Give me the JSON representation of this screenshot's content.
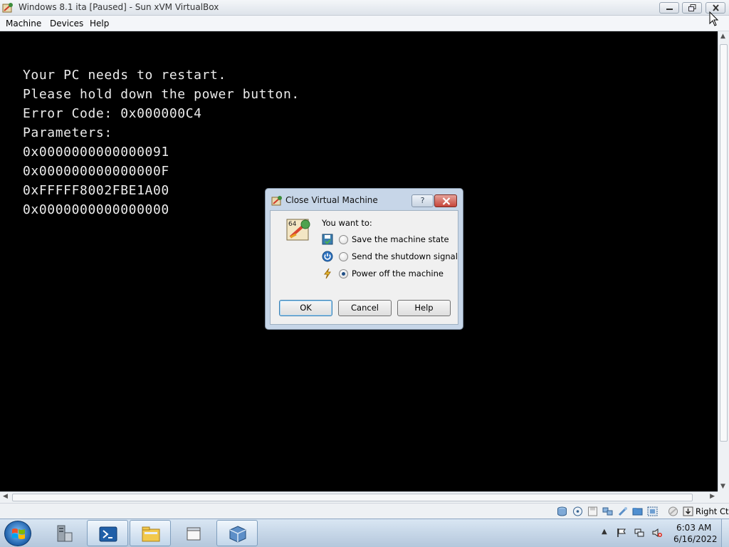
{
  "window": {
    "title": "Windows 8.1 ita [Paused] - Sun xVM VirtualBox",
    "controls": [
      "minimize",
      "restore",
      "close"
    ]
  },
  "menubar": {
    "items": [
      "Machine",
      "Devices",
      "Help"
    ]
  },
  "vm_screen": {
    "lines": [
      "Your PC needs to restart.",
      "Please hold down the power button.",
      "Error Code: 0x000000C4",
      "Parameters:",
      "0x0000000000000091",
      "0x000000000000000F",
      "0xFFFFF8002FBE1A00",
      "0x0000000000000000"
    ]
  },
  "dialog": {
    "title": "Close Virtual Machine",
    "help_glyph": "?",
    "prompt": "You want to:",
    "options": [
      {
        "label": "Save the machine state",
        "checked": false,
        "icon": "save-state-icon"
      },
      {
        "label": "Send the shutdown signal",
        "checked": false,
        "icon": "power-icon"
      },
      {
        "label": "Power off the machine",
        "checked": true,
        "icon": "lightning-icon"
      }
    ],
    "buttons": {
      "ok": "OK",
      "cancel": "Cancel",
      "help": "Help"
    }
  },
  "statusbar": {
    "icons": [
      "hard-disk-icon",
      "cd-icon",
      "floppy-icon",
      "network-icon",
      "usb-icon",
      "shared-folder-icon",
      "vrdp-icon",
      "mouse-integration-icon",
      "host-key-icon"
    ],
    "host_key": "Right Ctrl"
  },
  "taskbar": {
    "apps": [
      "server-manager-icon",
      "powershell-icon",
      "file-explorer-icon",
      "folder-icon",
      "virtualbox-icon"
    ],
    "tray": [
      "show-hidden-icons",
      "flag-icon",
      "network-icon",
      "volume-muted-icon"
    ],
    "clock": {
      "time": "6:03 AM",
      "date": "6/16/2022"
    }
  },
  "colors": {
    "vm_background": "#000000",
    "bsod_text": "#ececec",
    "dialog_frame": "#c7d6e8",
    "close_button": "#c6453a"
  }
}
